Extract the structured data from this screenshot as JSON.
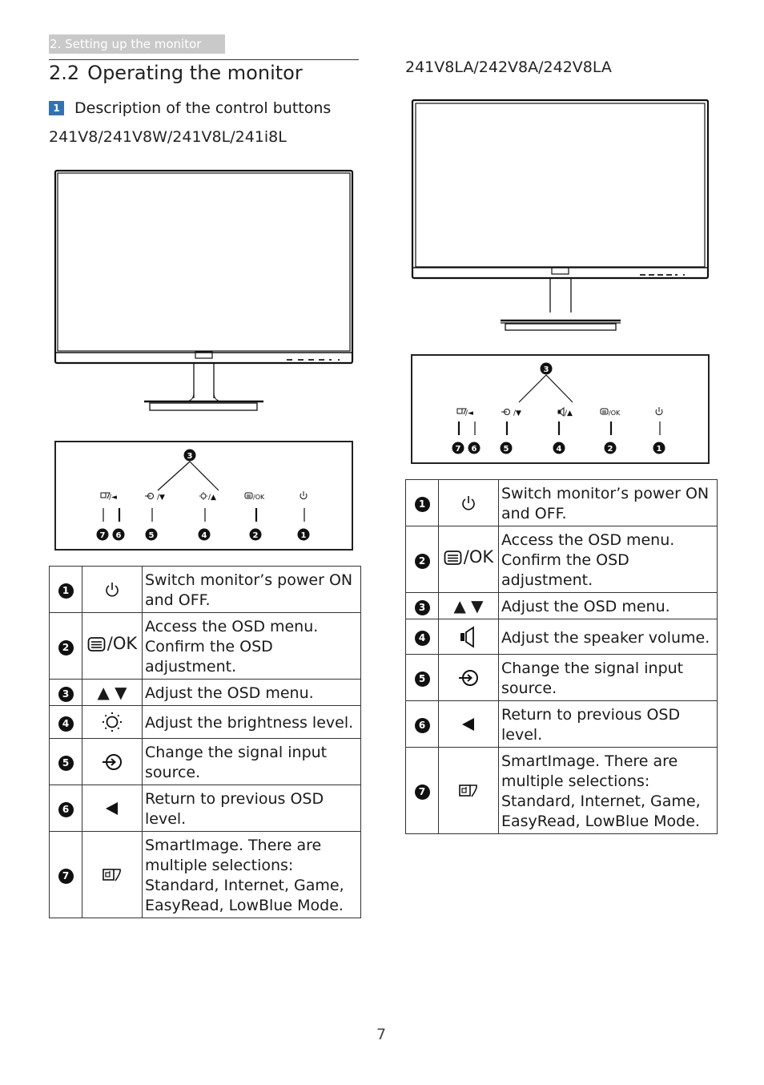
{
  "header": {
    "section_tab": "2. Setting up the monitor",
    "section_number": "2.2",
    "section_title": "Operating the monitor",
    "step_badge": "1",
    "step_title": "Description of the control buttons"
  },
  "left": {
    "models": "241V8/241V8W/241V8L/241i8L",
    "panel_buttons": [
      {
        "callout": "7",
        "icon": "smartimage-icon"
      },
      {
        "callout": "6",
        "icon": "left-triangle-icon",
        "label": "/◄"
      },
      {
        "callout": "5",
        "icon": "input-source-icon",
        "label": "/▼"
      },
      {
        "callout": "4",
        "icon": "brightness-icon",
        "label": "/▲"
      },
      {
        "callout": "2",
        "icon": "menu-icon",
        "label": "/OK"
      },
      {
        "callout": "1",
        "icon": "power-icon"
      }
    ],
    "panel_group_callout": "3",
    "rows": [
      {
        "num": "1",
        "icon": "power-icon",
        "desc": "Switch monitor’s power ON and OFF."
      },
      {
        "num": "2",
        "icon": "menu-ok-icon",
        "icon_text": "/OK",
        "desc": "Access the OSD menu. Confirm the OSD adjustment."
      },
      {
        "num": "3",
        "icon": "up-down-arrows-icon",
        "icon_text": "▲ ▼",
        "desc": "Adjust the OSD menu."
      },
      {
        "num": "4",
        "icon": "brightness-icon",
        "desc": "Adjust the brightness level."
      },
      {
        "num": "5",
        "icon": "input-source-icon",
        "desc": "Change the signal input source."
      },
      {
        "num": "6",
        "icon": "left-triangle-icon",
        "icon_text": "◀",
        "desc": "Return to previous OSD level."
      },
      {
        "num": "7",
        "icon": "smartimage-icon",
        "desc": "SmartImage. There are multiple selections: Standard, Internet, Game, EasyRead, LowBlue Mode."
      }
    ]
  },
  "right": {
    "models": "241V8LA/242V8A/242V8LA",
    "panel_group_callout": "3",
    "rows": [
      {
        "num": "1",
        "icon": "power-icon",
        "desc": "Switch monitor’s power ON and OFF."
      },
      {
        "num": "2",
        "icon": "menu-ok-icon",
        "icon_text": "/OK",
        "desc": "Access the OSD menu. Confirm the OSD adjustment."
      },
      {
        "num": "3",
        "icon": "up-down-arrows-icon",
        "icon_text": "▲ ▼",
        "desc": "Adjust the OSD menu."
      },
      {
        "num": "4",
        "icon": "speaker-icon",
        "desc": "Adjust the speaker volume."
      },
      {
        "num": "5",
        "icon": "input-source-icon",
        "desc": "Change the signal input source."
      },
      {
        "num": "6",
        "icon": "left-triangle-icon",
        "icon_text": "◀",
        "desc": "Return to previous OSD level."
      },
      {
        "num": "7",
        "icon": "smartimage-icon",
        "desc": "SmartImage. There are multiple selections: Standard, Internet, Game, EasyRead, LowBlue Mode."
      }
    ]
  },
  "panel_labels": {
    "ok": "/OK",
    "slash_left": "/◄",
    "slash_down": "/▼",
    "slash_up": "/▲"
  },
  "callouts": [
    "1",
    "2",
    "3",
    "4",
    "5",
    "6",
    "7"
  ],
  "page_number": "7"
}
